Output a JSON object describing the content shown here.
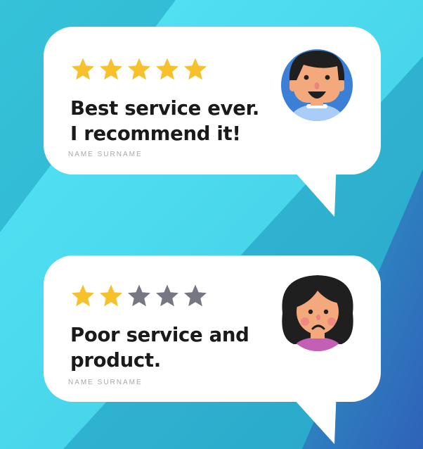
{
  "colors": {
    "bg_light": "#47dbee",
    "bg_mid": "#2fb3d4",
    "bg_dark": "#2f6fbf",
    "star_filled": "#f6c12b",
    "star_empty": "#767783",
    "text": "#1a1a1a",
    "muted": "#a8a8a8"
  },
  "reviews": [
    {
      "rating": 5,
      "max_rating": 5,
      "text": "Best service ever.\nI recommend it!",
      "author": "NAME SURNAME",
      "avatar": "happy-man-icon"
    },
    {
      "rating": 2,
      "max_rating": 5,
      "text": "Poor service and\nproduct.",
      "author": "NAME SURNAME",
      "avatar": "sad-woman-icon"
    }
  ]
}
